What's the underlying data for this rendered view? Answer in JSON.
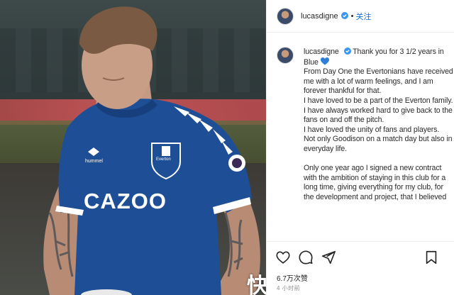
{
  "photo": {
    "shirt_sponsor": "CAZOO",
    "club_badge": "Everton",
    "kit_brand": "hummel"
  },
  "header": {
    "username": "lucasdigne",
    "separator": "•",
    "follow_label": "关注"
  },
  "caption": {
    "username": "lucasdigne",
    "first_line": "Thank you for 3 1/2 years in Blue",
    "lines": [
      "From Day One the Evertonians have received me with a lot of warm feelings, and I am forever thankful for that.",
      "I have loved to be a part of the Everton family.",
      "I have always worked hard to give back to the fans on and off the pitch.",
      "I have loved the unity of fans and players.",
      "Not only Goodison on a match day but also in everyday life."
    ],
    "paragraph2": "Only one year ago I signed a new contract with the ambition of staying in this club for a long time, giving everything for my club, for the development and project, that I believed"
  },
  "footer": {
    "likes": "6.7万次赞",
    "time": "4 小时前"
  },
  "watermark": "快",
  "icons": [
    "verified-badge-icon",
    "blue-heart-icon",
    "heart-icon",
    "comment-icon",
    "share-icon",
    "bookmark-icon"
  ],
  "colors": {
    "verified": "#3897f0",
    "follow": "#1570d8",
    "everton_blue": "#1d4e96",
    "heart_blue": "#2f7fd6"
  }
}
